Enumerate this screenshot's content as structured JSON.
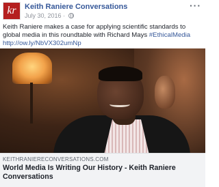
{
  "post": {
    "page_name": "Keith Raniere Conversations",
    "avatar_text": "kr",
    "date": "July 30, 2016",
    "dot": "·",
    "more": "···",
    "text_before": "Keith Raniere makes a case for applying scientific standards to global media in this roundtable with Richard Mays ",
    "hashtag": "#EthicalMedia",
    "link": "http://ow.ly/NbVX302umNp"
  },
  "link_preview": {
    "domain": "KEITHRANIERECONVERSATIONS.COM",
    "title": "World Media Is Writing Our History - Keith Raniere Conversations"
  },
  "colors": {
    "link": "#365899",
    "text": "#1d2129",
    "meta": "#90949c",
    "avatar_bg": "#b51f1f",
    "preview_bg": "#f2f3f5"
  },
  "icons": [
    "globe-icon",
    "more-options-icon"
  ]
}
